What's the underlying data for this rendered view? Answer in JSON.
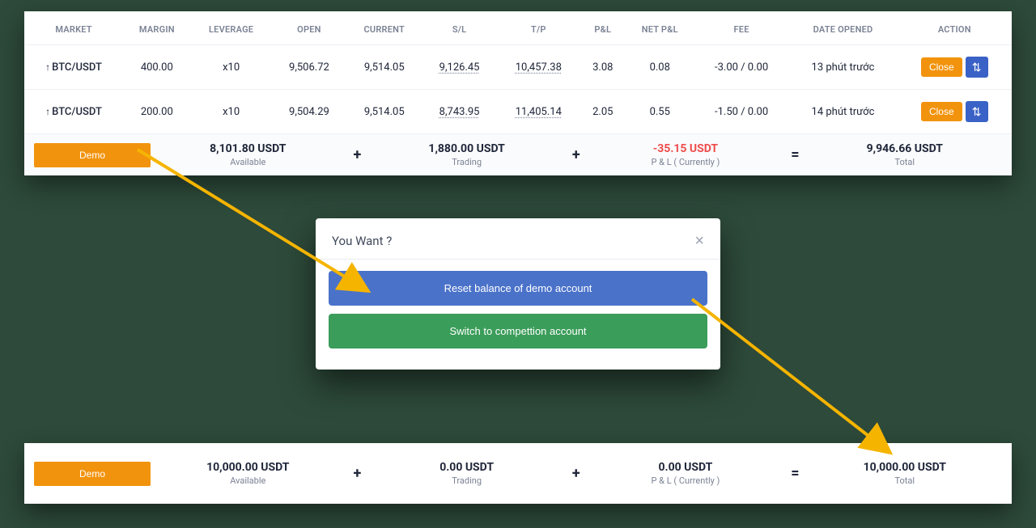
{
  "colors": {
    "accent": "#f2930d",
    "blue": "#4a72c9",
    "green": "#3b9d5a",
    "neg": "#ef4b4b",
    "pos": "#22b07d"
  },
  "table": {
    "headers": [
      "MARKET",
      "MARGIN",
      "LEVERAGE",
      "OPEN",
      "CURRENT",
      "S/L",
      "T/P",
      "P&L",
      "NET P&L",
      "FEE",
      "DATE OPENED",
      "ACTION"
    ],
    "rows": [
      {
        "market": "BTC/USDT",
        "margin": "400.00",
        "leverage": "x10",
        "open": "9,506.72",
        "current": "9,514.05",
        "sl": "9,126.45",
        "tp": "10,457.38",
        "pl": "3.08",
        "net": "0.08",
        "fee": "-3.00 / 0.00",
        "date": "13 phút trước"
      },
      {
        "market": "BTC/USDT",
        "margin": "200.00",
        "leverage": "x10",
        "open": "9,504.29",
        "current": "9,514.05",
        "sl": "8,743.95",
        "tp": "11,405.14",
        "pl": "2.05",
        "net": "0.55",
        "fee": "-1.50 / 0.00",
        "date": "14 phút trước"
      }
    ],
    "close_label": "Close"
  },
  "summary_before": {
    "demo_label": "Demo",
    "available": {
      "value": "8,101.80 USDT",
      "label": "Available"
    },
    "trading": {
      "value": "1,880.00 USDT",
      "label": "Trading"
    },
    "pnl": {
      "value": "-35.15 USDT",
      "label": "P & L ( Currently )"
    },
    "total": {
      "value": "9,946.66 USDT",
      "label": "Total"
    }
  },
  "modal": {
    "title": "You Want ?",
    "reset": "Reset balance of demo account",
    "switch": "Switch to compettion account"
  },
  "summary_after": {
    "demo_label": "Demo",
    "available": {
      "value": "10,000.00 USDT",
      "label": "Available"
    },
    "trading": {
      "value": "0.00 USDT",
      "label": "Trading"
    },
    "pnl": {
      "value": "0.00 USDT",
      "label": "P & L ( Currently )"
    },
    "total": {
      "value": "10,000.00 USDT",
      "label": "Total"
    }
  }
}
